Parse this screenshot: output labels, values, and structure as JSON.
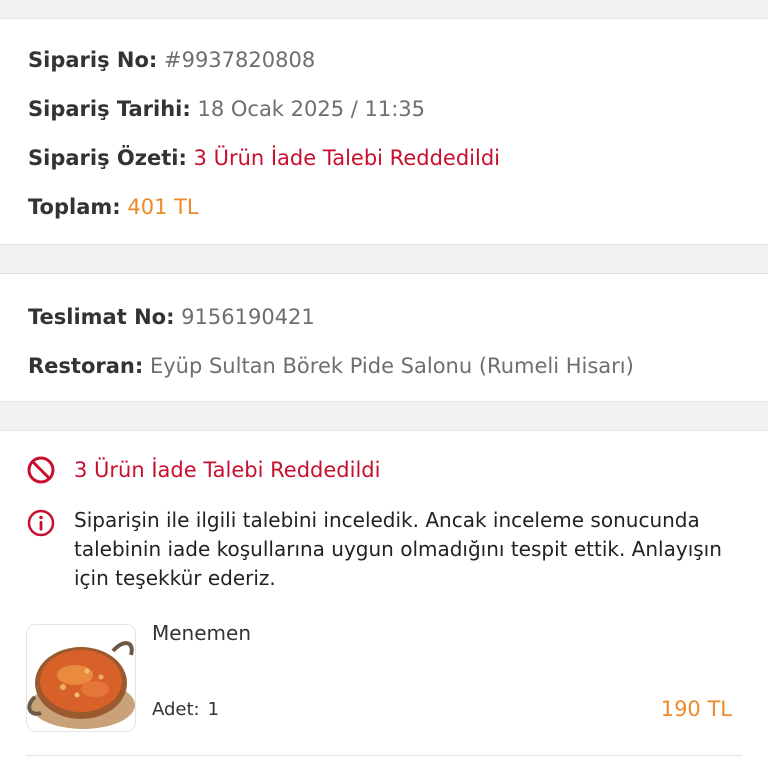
{
  "order": {
    "number_label": "Sipariş No:",
    "number_value": "#9937820808",
    "date_label": "Sipariş Tarihi:",
    "date_value": "18 Ocak 2025 / 11:35",
    "summary_label": "Sipariş Özeti:",
    "summary_value": "3 Ürün İade Talebi Reddedildi",
    "total_label": "Toplam:",
    "total_value": "401 TL"
  },
  "delivery": {
    "number_label": "Teslimat No:",
    "number_value": "9156190421",
    "restaurant_label": "Restoran:",
    "restaurant_value": "Eyüp Sultan Börek Pide Salonu (Rumeli Hisarı)"
  },
  "return_request": {
    "status_title": "3 Ürün İade Talebi Reddedildi",
    "status_icon": "prohibited-icon",
    "info_icon": "info-icon",
    "message": "Siparişin ile ilgili talebini inceledik. Ancak inceleme sonucunda talebinin iade koşullarına uygun olmadığını tespit ettik. Anlayışın için teşekkür ederiz.",
    "product": {
      "name": "Menemen",
      "quantity_label": "Adet:",
      "quantity_value": "1",
      "price": "190 TL"
    }
  },
  "colors": {
    "accent_red": "#c8102e",
    "accent_orange": "#ee8a27",
    "background": "#f2f2f2"
  }
}
